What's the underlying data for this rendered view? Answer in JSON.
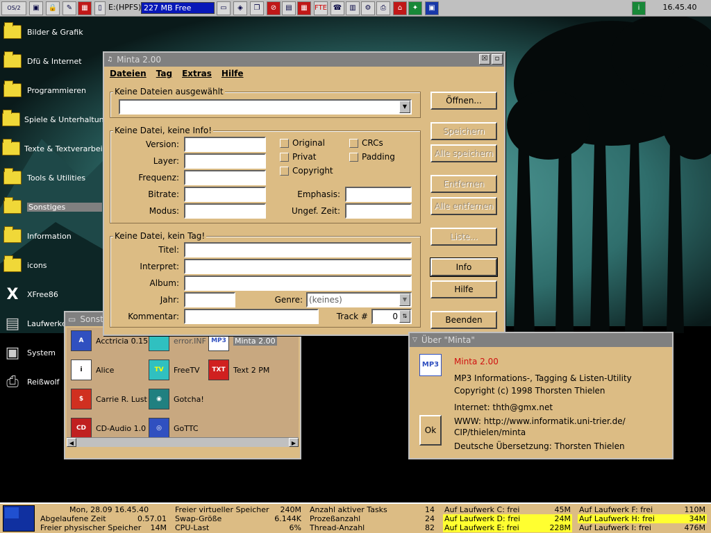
{
  "topbar": {
    "drive": "E:(HPFS)",
    "memory": "227 MB Free",
    "clock": "16.45.40"
  },
  "desktop_icons": [
    {
      "label": "Bilder & Grafik",
      "icon": "folder-icon"
    },
    {
      "label": "Dfü & Internet",
      "icon": "folder-icon"
    },
    {
      "label": "Programmieren",
      "icon": "folder-icon"
    },
    {
      "label": "Spiele & Unterhaltung",
      "icon": "folder-icon"
    },
    {
      "label": "Texte & Textverarbeitung",
      "icon": "folder-icon"
    },
    {
      "label": "Tools & Utilities",
      "icon": "folder-icon"
    },
    {
      "label": "Sonstiges",
      "icon": "folder-open-icon"
    },
    {
      "label": "Information",
      "icon": "info-folder-icon"
    },
    {
      "label": "icons",
      "icon": "folder-icon"
    },
    {
      "label": "XFree86",
      "icon": "xfree86-icon"
    },
    {
      "label": "Laufwerke",
      "icon": "drives-icon"
    },
    {
      "label": "System",
      "icon": "computer-icon"
    },
    {
      "label": "Reißwolf",
      "icon": "shredder-icon"
    }
  ],
  "minta": {
    "title": "Minta 2.00",
    "menu": [
      "Dateien",
      "Tag",
      "Extras",
      "Hilfe"
    ],
    "files_group": "Keine Dateien ausgewählt",
    "info_group": "Keine Datei, keine Info!",
    "info_labels": {
      "version": "Version:",
      "layer": "Layer:",
      "frequenz": "Frequenz:",
      "bitrate": "Bitrate:",
      "modus": "Modus:",
      "emphasis": "Emphasis:",
      "zeit": "Ungef. Zeit:"
    },
    "checkboxes": [
      "Original",
      "Privat",
      "Copyright",
      "CRCs",
      "Padding"
    ],
    "tag_group": "Keine Datei, kein Tag!",
    "tag_labels": {
      "titel": "Titel:",
      "interpret": "Interpret:",
      "album": "Album:",
      "jahr": "Jahr:",
      "genre": "Genre:",
      "kommentar": "Kommentar:",
      "track": "Track #"
    },
    "genre_value": "(keines)",
    "track_value": "0",
    "buttons": {
      "open": "Öffnen...",
      "save": "Speichern",
      "save_all": "Alle speichern",
      "remove": "Entfernen",
      "remove_all": "Alle entfernen",
      "list": "Liste...",
      "info": "Info",
      "help": "Hilfe",
      "quit": "Beenden"
    }
  },
  "folder": {
    "title": "Sonstiges",
    "items": [
      {
        "label": "Acctricia 0.15",
        "icon": "acctricia-icon"
      },
      {
        "label": "error.INF",
        "icon": "document-icon"
      },
      {
        "label": "Minta 2.00",
        "icon": "mp3-icon"
      },
      {
        "label": "Alice",
        "icon": "alice-icon"
      },
      {
        "label": "FreeTV",
        "icon": "tv-icon"
      },
      {
        "label": "Text 2 PM",
        "icon": "text2pm-icon"
      },
      {
        "label": "Carrie R. Lust",
        "icon": "phone-icon"
      },
      {
        "label": "Gotcha!",
        "icon": "camera-icon"
      },
      {
        "label": "CD-Audio 1.0",
        "icon": "cd-audio-icon"
      },
      {
        "label": "GoTTC",
        "icon": "cd-icon"
      }
    ]
  },
  "about": {
    "title": "Über \"Minta\"",
    "app": "Minta 2.00",
    "desc": "MP3 Informations-, Tagging & Listen-Utility",
    "copyright": "Copyright (c) 1998 Thorsten Thielen",
    "internet": "Internet: thth@gmx.net",
    "www1": "WWW: http://www.informatik.uni-trier.de/",
    "www2": "CIP/thielen/minta",
    "translation": "Deutsche Übersetzung: Thorsten Thielen",
    "ok": "Ok"
  },
  "status": {
    "datetime": "Mon, 28.09 16.45.40",
    "col1": [
      [
        "Abgelaufene Zeit",
        "0.57.01"
      ],
      [
        "Freier physischer Speicher",
        "14M"
      ]
    ],
    "col2": [
      [
        "Freier virtueller Speicher",
        "240M"
      ],
      [
        "Swap-Größe",
        "6.144K"
      ],
      [
        "CPU-Last",
        "6%"
      ]
    ],
    "col3": [
      [
        "Anzahl aktiver Tasks",
        "14"
      ],
      [
        "Prozeßanzahl",
        "24"
      ],
      [
        "Thread-Anzahl",
        "82"
      ]
    ],
    "col4": [
      [
        "Auf Laufwerk C: frei",
        "45M"
      ],
      [
        "Auf Laufwerk D: frei",
        "24M"
      ],
      [
        "Auf Laufwerk E: frei",
        "228M"
      ]
    ],
    "col5": [
      [
        "Auf Laufwerk F: frei",
        "110M"
      ],
      [
        "Auf Laufwerk H: frei",
        "34M"
      ],
      [
        "Auf Laufwerk I: frei",
        "476M"
      ]
    ]
  },
  "colors": {
    "desktop_teal": "#3a7a78",
    "window_tan": "#dcbc84",
    "highlight": "#ffff30",
    "gauge": "#0818b8"
  }
}
